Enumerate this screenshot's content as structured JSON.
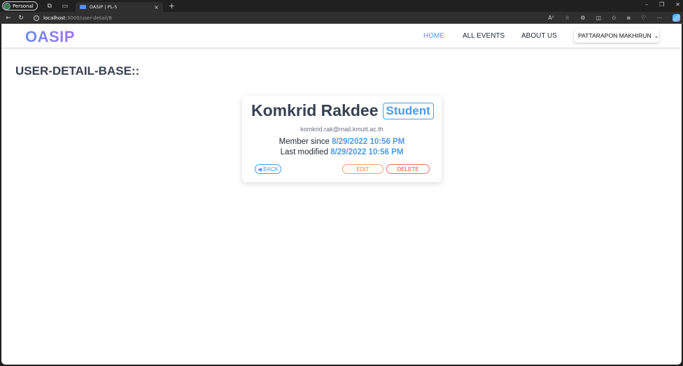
{
  "browser": {
    "profile_label": "Personal",
    "tab_title": "OASIP | PL-5",
    "tab_close": "×",
    "new_tab": "+",
    "url_host": "localhost",
    "url_path": ":3000/user-detail/8",
    "reader_label": "Aᴬ"
  },
  "app": {
    "logo": "OASIP",
    "nav": {
      "home": "HOME",
      "all_events": "ALL EVENTS",
      "about_us": "ABOUT US"
    },
    "user_menu_label": "PATTARAPON MAKHIRUN",
    "accent_color": "#4d9be6"
  },
  "page": {
    "title": "USER-DETAIL-BASE::"
  },
  "user": {
    "name": "Komkrid Rakdee",
    "role": "Student",
    "email": "komkrid.rak@mail.kmutt.ac.th",
    "member_since_label": "Member since",
    "member_since": "8/29/2022 10:56 PM",
    "last_modified_label": "Last modified",
    "last_modified": "8/29/2022 10:56 PM"
  },
  "actions": {
    "back": "BACK",
    "edit": "EDIT",
    "delete": "DELETE"
  }
}
